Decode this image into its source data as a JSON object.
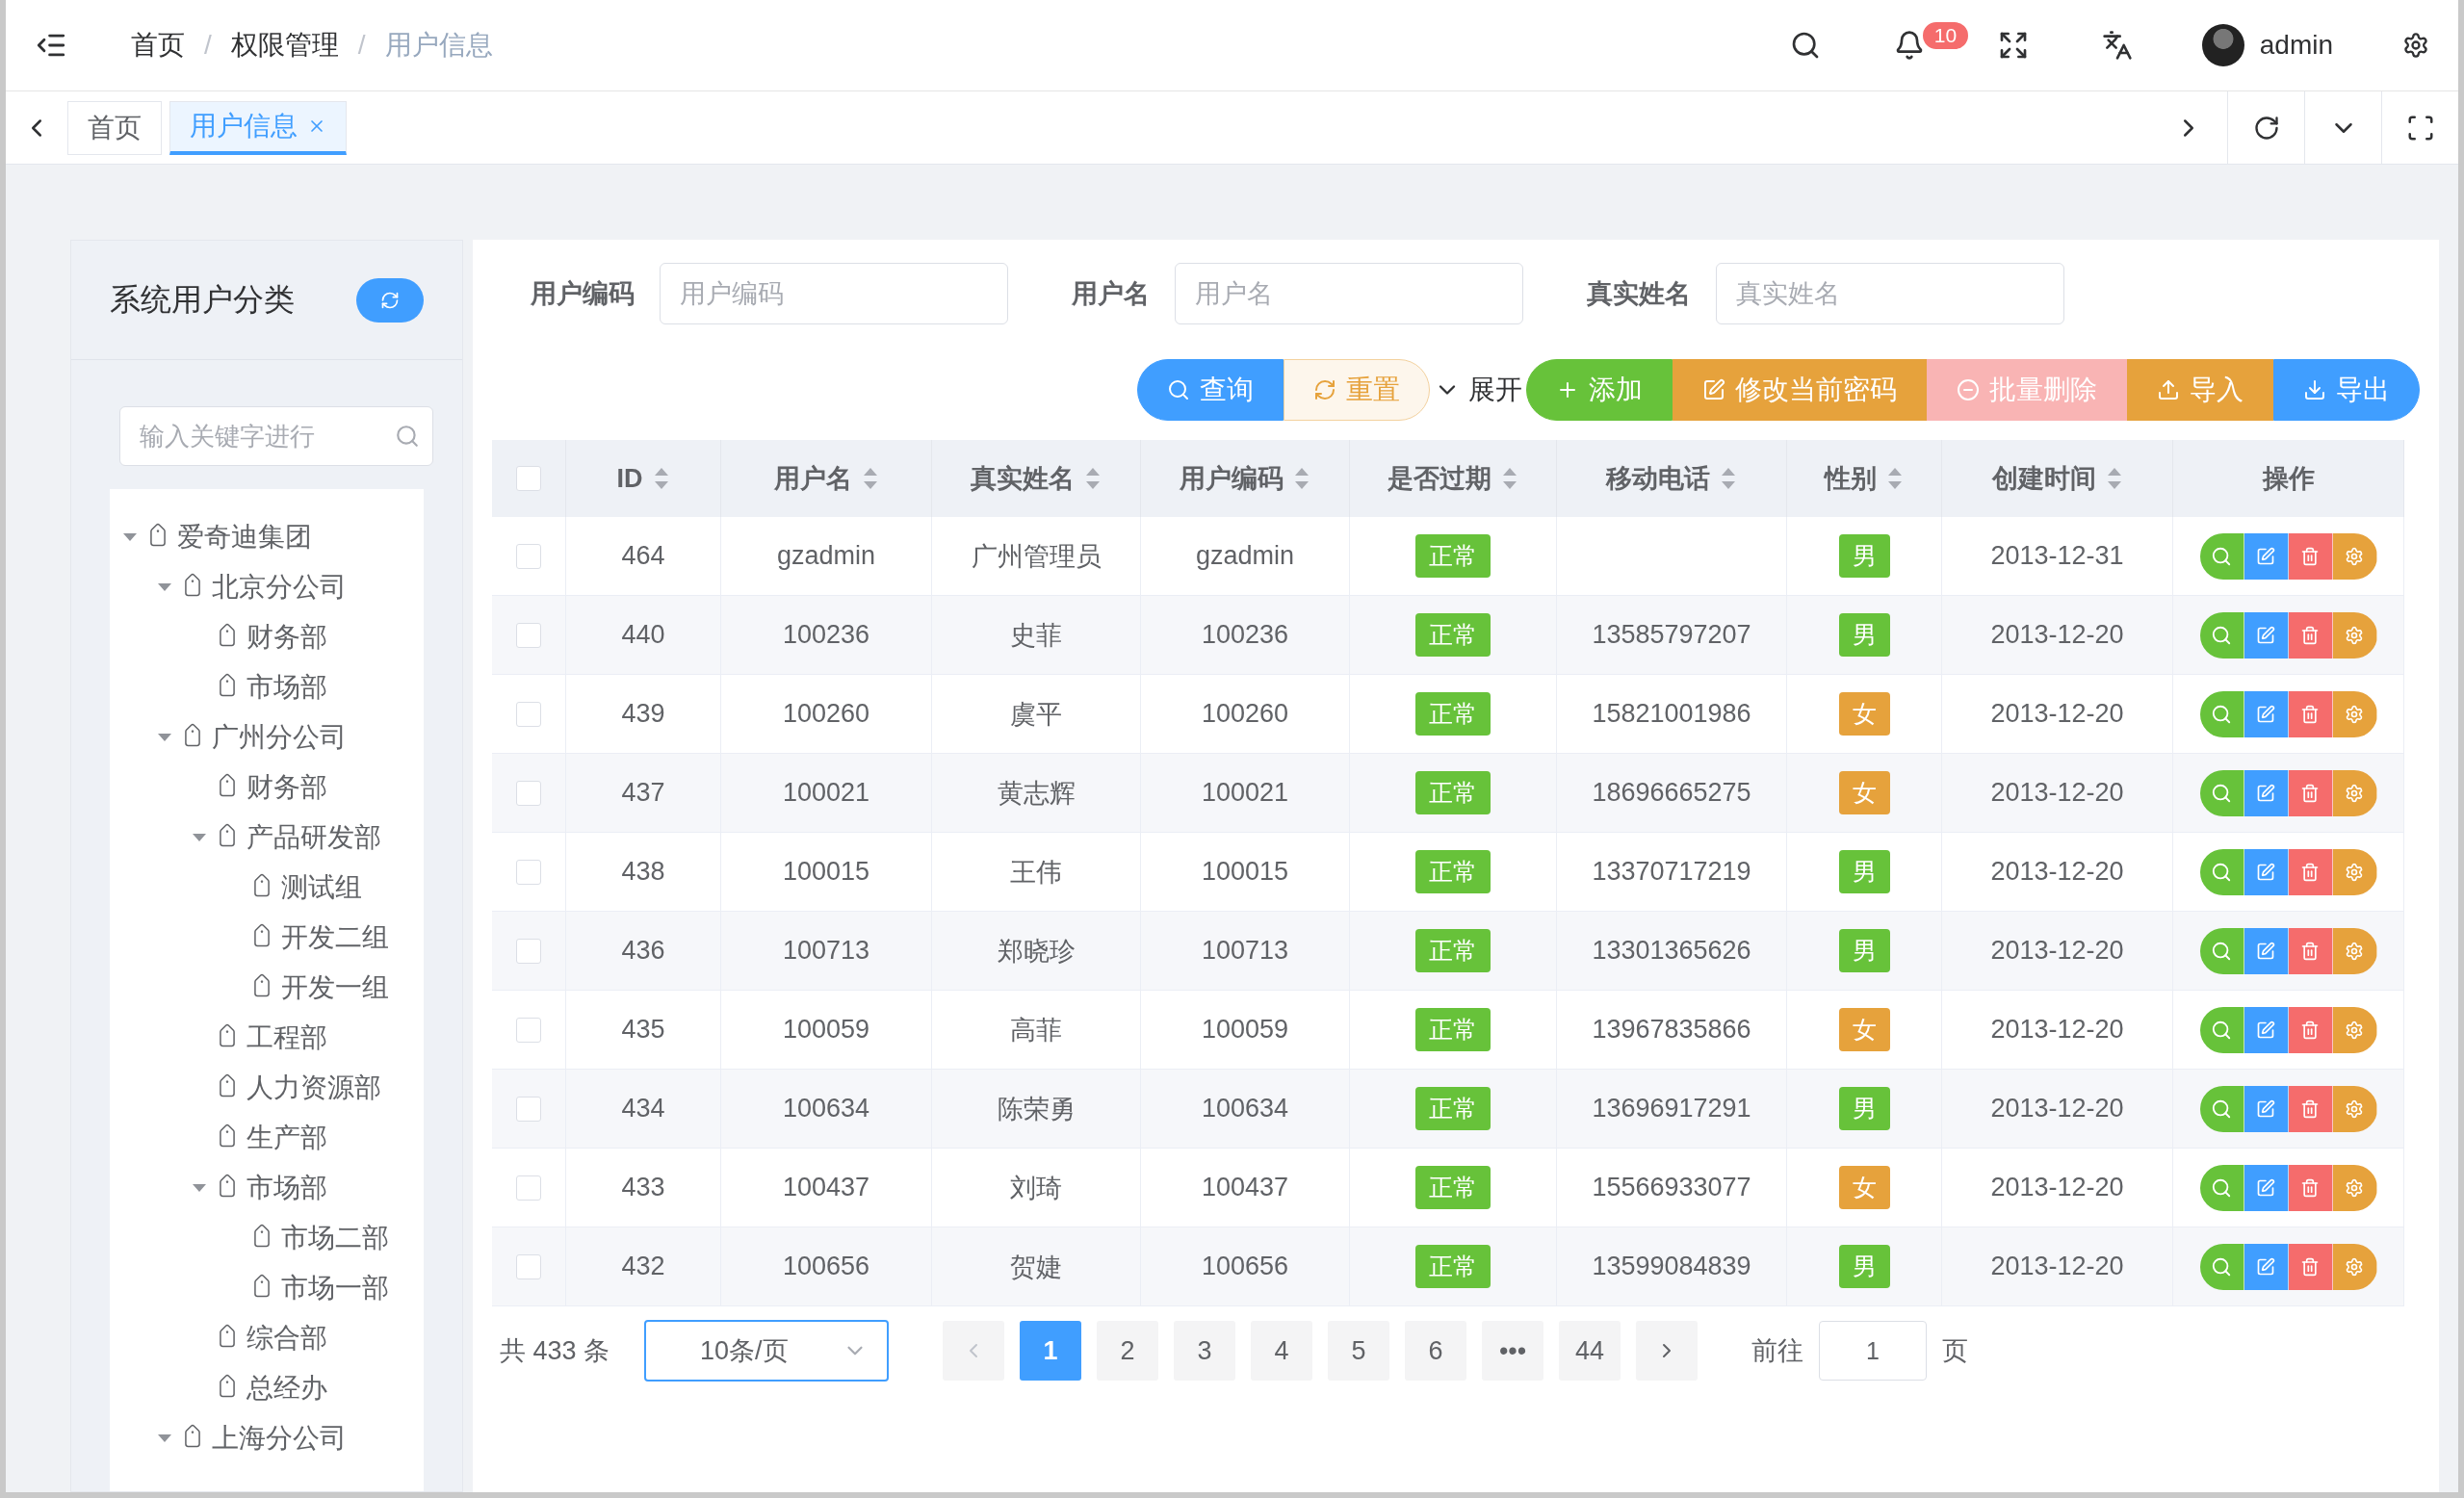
{
  "header": {
    "breadcrumb": [
      "首页",
      "权限管理",
      "用户信息"
    ],
    "separator": "/",
    "notifications": "10",
    "user": "admin"
  },
  "tabs": [
    {
      "label": "首页",
      "selected": false,
      "closable": false
    },
    {
      "label": "用户信息",
      "selected": true,
      "closable": true
    }
  ],
  "sidebar": {
    "title": "系统用户分类",
    "search": {
      "placeholder": "输入关键字进行"
    },
    "tree": [
      {
        "label": "爱奇迪集团",
        "expanded": true,
        "children": [
          {
            "label": "北京分公司",
            "expanded": true,
            "children": [
              {
                "label": "财务部"
              },
              {
                "label": "市场部"
              }
            ]
          },
          {
            "label": "广州分公司",
            "expanded": true,
            "children": [
              {
                "label": "财务部"
              },
              {
                "label": "产品研发部",
                "expanded": true,
                "children": [
                  {
                    "label": "测试组"
                  },
                  {
                    "label": "开发二组"
                  },
                  {
                    "label": "开发一组"
                  }
                ]
              },
              {
                "label": "工程部"
              },
              {
                "label": "人力资源部"
              },
              {
                "label": "生产部"
              },
              {
                "label": "市场部",
                "expanded": true,
                "children": [
                  {
                    "label": "市场二部"
                  },
                  {
                    "label": "市场一部"
                  }
                ]
              },
              {
                "label": "综合部"
              },
              {
                "label": "总经办"
              }
            ]
          },
          {
            "label": "上海分公司",
            "expanded": true
          }
        ]
      }
    ]
  },
  "filters": [
    {
      "label": "用户编码",
      "placeholder": "用户编码"
    },
    {
      "label": "用户名",
      "placeholder": "用户名"
    },
    {
      "label": "真实姓名",
      "placeholder": "真实姓名"
    }
  ],
  "toolbar": {
    "toggle": {
      "label": "展开",
      "expanded": false
    },
    "actions": [
      {
        "label": "查询",
        "kind": "query",
        "disabled": false
      },
      {
        "label": "重置",
        "kind": "reset",
        "disabled": false
      },
      {
        "label": "添加",
        "kind": "add",
        "disabled": false
      },
      {
        "label": "修改当前密码",
        "kind": "edit",
        "disabled": false
      },
      {
        "label": "批量删除",
        "kind": "delete",
        "disabled": true
      },
      {
        "label": "导入",
        "kind": "import",
        "disabled": false
      },
      {
        "label": "导出",
        "kind": "export",
        "disabled": false
      }
    ]
  },
  "table": {
    "all_selected": false,
    "columns": [
      {
        "label": "ID",
        "sortable": true
      },
      {
        "label": "用户名",
        "sortable": true
      },
      {
        "label": "真实姓名",
        "sortable": true
      },
      {
        "label": "用户编码",
        "sortable": true
      },
      {
        "label": "是否过期",
        "sortable": true
      },
      {
        "label": "移动电话",
        "sortable": true
      },
      {
        "label": "性别",
        "sortable": true
      },
      {
        "label": "创建时间",
        "sortable": true
      },
      {
        "label": "操作",
        "sortable": false
      }
    ],
    "rows": [
      {
        "selected": false,
        "id": "464",
        "username": "gzadmin",
        "real_name": "广州管理员",
        "code": "gzadmin",
        "status": "正常",
        "gender": {
          "text": "男",
          "color": "#67c23a"
        },
        "created": "2013-12-31"
      },
      {
        "selected": false,
        "id": "440",
        "username": "100236",
        "real_name": "史菲",
        "code": "100236",
        "status": "正常",
        "phone": "13585797207",
        "gender": {
          "text": "男",
          "color": "#67c23a"
        },
        "created": "2013-12-20"
      },
      {
        "selected": false,
        "id": "439",
        "username": "100260",
        "real_name": "虞平",
        "code": "100260",
        "status": "正常",
        "phone": "15821001986",
        "gender": {
          "text": "女",
          "color": "#e6a23c"
        },
        "created": "2013-12-20"
      },
      {
        "selected": false,
        "id": "437",
        "username": "100021",
        "real_name": "黄志辉",
        "code": "100021",
        "status": "正常",
        "phone": "18696665275",
        "gender": {
          "text": "女",
          "color": "#e6a23c"
        },
        "created": "2013-12-20"
      },
      {
        "selected": false,
        "id": "438",
        "username": "100015",
        "real_name": "王伟",
        "code": "100015",
        "status": "正常",
        "phone": "13370717219",
        "gender": {
          "text": "男",
          "color": "#67c23a"
        },
        "created": "2013-12-20"
      },
      {
        "selected": false,
        "id": "436",
        "username": "100713",
        "real_name": "郑晓珍",
        "code": "100713",
        "status": "正常",
        "phone": "13301365626",
        "gender": {
          "text": "男",
          "color": "#67c23a"
        },
        "created": "2013-12-20"
      },
      {
        "selected": false,
        "id": "435",
        "username": "100059",
        "real_name": "高菲",
        "code": "100059",
        "status": "正常",
        "phone": "13967835866",
        "gender": {
          "text": "女",
          "color": "#e6a23c"
        },
        "created": "2013-12-20"
      },
      {
        "selected": false,
        "id": "434",
        "username": "100634",
        "real_name": "陈荣勇",
        "code": "100634",
        "status": "正常",
        "phone": "13696917291",
        "gender": {
          "text": "男",
          "color": "#67c23a"
        },
        "created": "2013-12-20"
      },
      {
        "selected": false,
        "id": "433",
        "username": "100437",
        "real_name": "刘琦",
        "code": "100437",
        "status": "正常",
        "phone": "15566933077",
        "gender": {
          "text": "女",
          "color": "#e6a23c"
        },
        "created": "2013-12-20"
      },
      {
        "selected": false,
        "id": "432",
        "username": "100656",
        "real_name": "贺婕",
        "code": "100656",
        "status": "正常",
        "phone": "13599084839",
        "gender": {
          "text": "男",
          "color": "#67c23a"
        },
        "created": "2013-12-20"
      }
    ]
  },
  "pagination": {
    "total": "共 433 条",
    "page_size": "10条/页",
    "pages": [
      {
        "label": "1",
        "selected": true
      },
      {
        "label": "2",
        "selected": false
      },
      {
        "label": "3",
        "selected": false
      },
      {
        "label": "4",
        "selected": false
      },
      {
        "label": "5",
        "selected": false
      },
      {
        "label": "6",
        "selected": false
      },
      {
        "label": "•••",
        "selected": false
      },
      {
        "label": "44",
        "selected": false
      }
    ],
    "goto_label": "前往",
    "goto_value": "1",
    "goto_suffix": "页"
  }
}
